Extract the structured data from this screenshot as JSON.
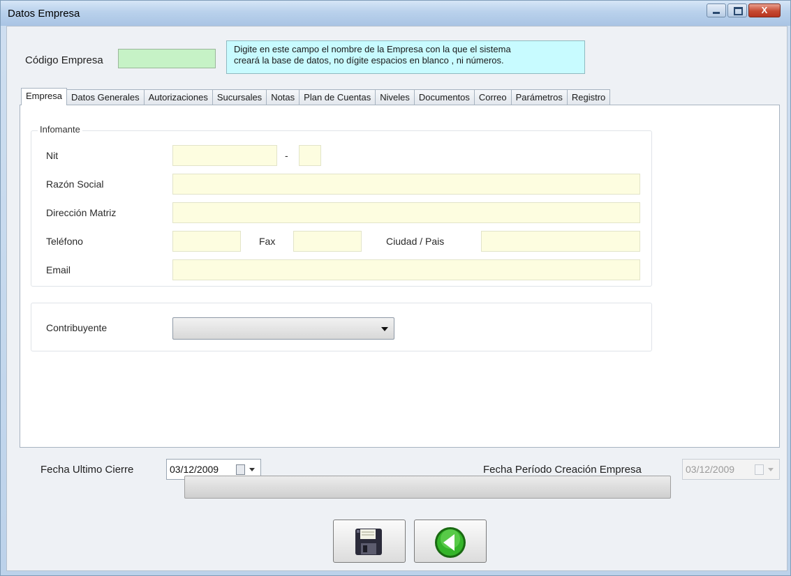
{
  "window": {
    "title": "Datos  Empresa",
    "close_label": "X"
  },
  "header": {
    "codigo_label": "Código Empresa",
    "codigo_value": "",
    "hint_line1": "Digite en este campo el nombre de la Empresa con la que el sistema",
    "hint_line2": "creará la base de datos, no dígite espacios en blanco , ni números."
  },
  "tabs": [
    {
      "label": "Empresa",
      "active": true
    },
    {
      "label": "Datos Generales"
    },
    {
      "label": "Autorizaciones"
    },
    {
      "label": "Sucursales"
    },
    {
      "label": "Notas"
    },
    {
      "label": "Plan de  Cuentas"
    },
    {
      "label": "Niveles"
    },
    {
      "label": "Documentos"
    },
    {
      "label": "Correo"
    },
    {
      "label": "Parámetros"
    },
    {
      "label": "Registro"
    }
  ],
  "informante": {
    "legend": "Infomante",
    "nit_label": "Nit",
    "nit_separator": "-",
    "razon_label": "Razón Social",
    "direccion_label": "Dirección Matriz",
    "telefono_label": "Teléfono",
    "fax_label": "Fax",
    "ciudad_label": "Ciudad / Pais",
    "email_label": "Email"
  },
  "contribuyente": {
    "label": "Contribuyente",
    "selected": ""
  },
  "footer": {
    "fecha_cierre_label": "Fecha Ultimo Cierre",
    "fecha_cierre_value": "03/12/2009",
    "fecha_creacion_label": "Fecha Período Creación Empresa",
    "fecha_creacion_value": "03/12/2009",
    "progress": 0
  },
  "colors": {
    "codigo_field": "#c6f2c6",
    "hint_bg": "#c8fbff",
    "input_bg": "#fdfde0"
  }
}
